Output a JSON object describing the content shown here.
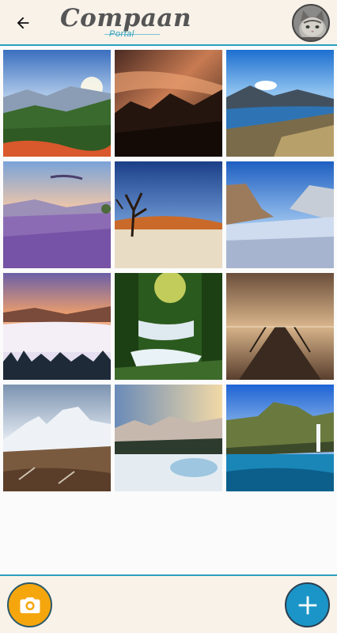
{
  "header": {
    "title": "Compaan",
    "subtitle": "Portal",
    "back_icon": "arrow-left-icon",
    "avatar": "cat-avatar"
  },
  "gallery": {
    "photos": [
      {
        "subject": "mountain-sunrise-valley"
      },
      {
        "subject": "misty-forest-hills"
      },
      {
        "subject": "mountain-lake"
      },
      {
        "subject": "lavender-field-sunset"
      },
      {
        "subject": "desert-dead-tree"
      },
      {
        "subject": "snowy-valley-cliffs"
      },
      {
        "subject": "foggy-sunset-forest"
      },
      {
        "subject": "forest-waterfall"
      },
      {
        "subject": "pier-sunset"
      },
      {
        "subject": "snowy-peaks-autumn"
      },
      {
        "subject": "frozen-lake-mountains"
      },
      {
        "subject": "coastal-cliff-waterfall"
      }
    ]
  },
  "footer": {
    "camera_icon": "camera-icon",
    "add_icon": "plus-icon"
  },
  "colors": {
    "accent": "#2aa0bf",
    "header_bg": "#f8f2e9",
    "camera_button": "#f5a60d",
    "add_button": "#1b95c7"
  }
}
